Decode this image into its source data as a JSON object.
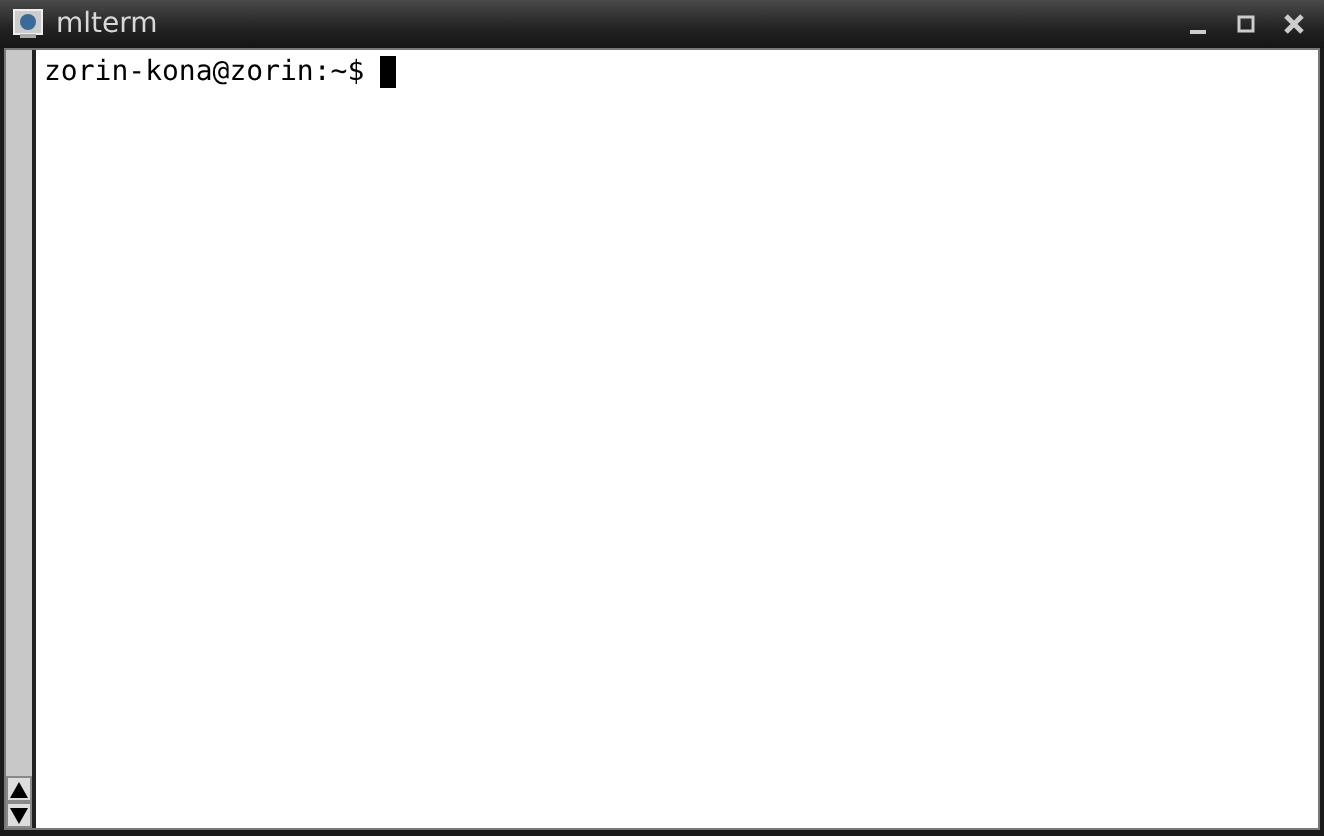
{
  "window": {
    "title": "mlterm"
  },
  "terminal": {
    "prompt": "zorin-kona@zorin:~$"
  }
}
